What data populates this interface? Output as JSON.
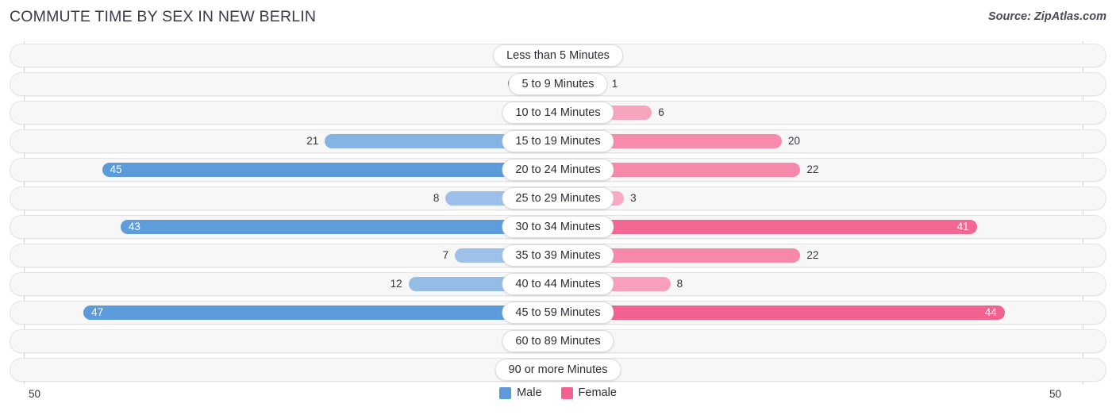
{
  "header": {
    "title": "COMMUTE TIME BY SEX IN NEW BERLIN",
    "source": "Source: ZipAtlas.com"
  },
  "axis": {
    "min_label": "50",
    "max_label": "50"
  },
  "legend": {
    "items": [
      {
        "label": "Male",
        "color": "#5b9bd9"
      },
      {
        "label": "Female",
        "color": "#f2628f"
      }
    ]
  },
  "chart_data": {
    "type": "bar",
    "orientation": "horizontal-diverging",
    "title": "COMMUTE TIME BY SEX IN NEW BERLIN",
    "xlabel": "",
    "ylabel": "",
    "xlim": [
      50,
      50
    ],
    "grid": false,
    "legend_position": "bottom-center",
    "categories": [
      "Less than 5 Minutes",
      "5 to 9 Minutes",
      "10 to 14 Minutes",
      "15 to 19 Minutes",
      "20 to 24 Minutes",
      "25 to 29 Minutes",
      "30 to 34 Minutes",
      "35 to 39 Minutes",
      "40 to 44 Minutes",
      "45 to 59 Minutes",
      "60 to 89 Minutes",
      "90 or more Minutes"
    ],
    "series": [
      {
        "name": "Male",
        "values": [
          0,
          0,
          0,
          21,
          45,
          8,
          43,
          7,
          12,
          47,
          0,
          1
        ]
      },
      {
        "name": "Female",
        "values": [
          0,
          1,
          6,
          20,
          22,
          3,
          41,
          22,
          8,
          44,
          0,
          0
        ]
      }
    ]
  },
  "rows": [
    {
      "category": "Less than 5 Minutes",
      "male": "0",
      "female": "0",
      "male_v": 0,
      "female_v": 0
    },
    {
      "category": "5 to 9 Minutes",
      "male": "0",
      "female": "1",
      "male_v": 0,
      "female_v": 1
    },
    {
      "category": "10 to 14 Minutes",
      "male": "0",
      "female": "6",
      "male_v": 0,
      "female_v": 6
    },
    {
      "category": "15 to 19 Minutes",
      "male": "21",
      "female": "20",
      "male_v": 21,
      "female_v": 20
    },
    {
      "category": "20 to 24 Minutes",
      "male": "45",
      "female": "22",
      "male_v": 45,
      "female_v": 22
    },
    {
      "category": "25 to 29 Minutes",
      "male": "8",
      "female": "3",
      "male_v": 8,
      "female_v": 3
    },
    {
      "category": "30 to 34 Minutes",
      "male": "43",
      "female": "41",
      "male_v": 43,
      "female_v": 41
    },
    {
      "category": "35 to 39 Minutes",
      "male": "7",
      "female": "22",
      "male_v": 7,
      "female_v": 22
    },
    {
      "category": "40 to 44 Minutes",
      "male": "12",
      "female": "8",
      "male_v": 12,
      "female_v": 8
    },
    {
      "category": "45 to 59 Minutes",
      "male": "47",
      "female": "44",
      "male_v": 47,
      "female_v": 44
    },
    {
      "category": "60 to 89 Minutes",
      "male": "0",
      "female": "0",
      "male_v": 0,
      "female_v": 0
    },
    {
      "category": "90 or more Minutes",
      "male": "1",
      "female": "0",
      "male_v": 1,
      "female_v": 0
    }
  ]
}
